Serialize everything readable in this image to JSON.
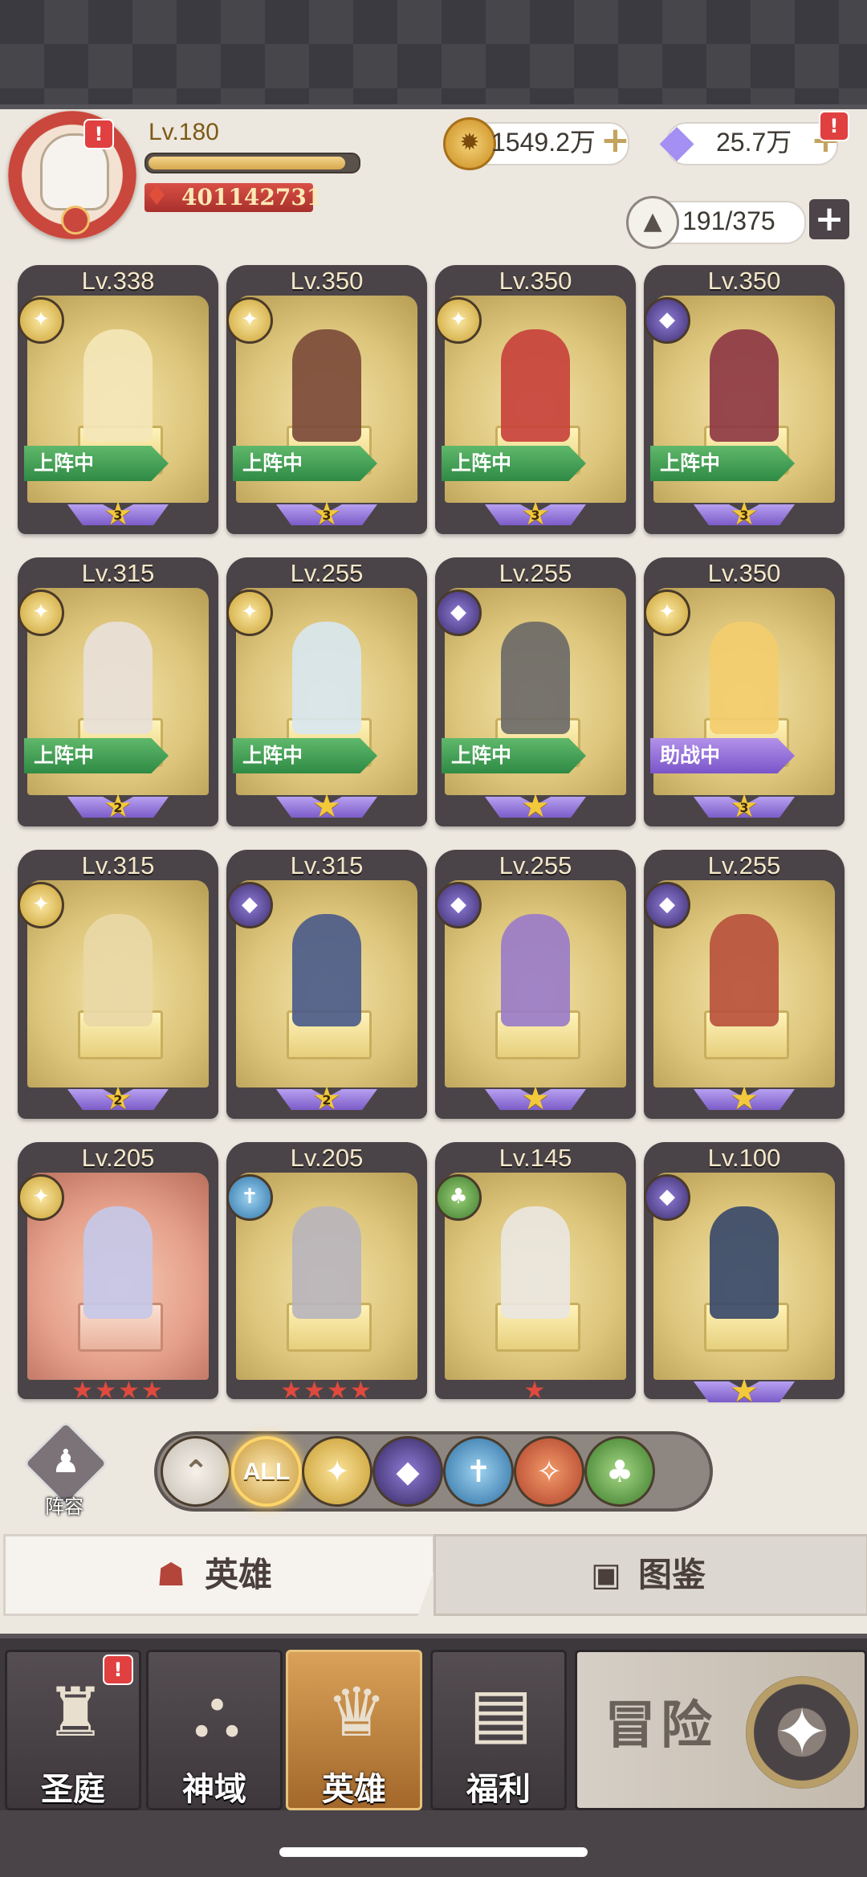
{
  "player": {
    "level": "Lv.180",
    "xp_fraction": 0.96,
    "power": "401142731",
    "alert": "!"
  },
  "resources": {
    "gold": "1549.2万",
    "diamonds": "25.7万",
    "diamond_alert": "!",
    "hero_capacity": "191/375"
  },
  "heroes": [
    {
      "level": "Lv.338",
      "faction": "light",
      "status": "上阵中",
      "stars": "3",
      "frame": "gold"
    },
    {
      "level": "Lv.350",
      "faction": "light",
      "status": "上阵中",
      "stars": "3",
      "frame": "gold"
    },
    {
      "level": "Lv.350",
      "faction": "light",
      "status": "上阵中",
      "stars": "3",
      "frame": "gold"
    },
    {
      "level": "Lv.350",
      "faction": "dark",
      "status": "上阵中",
      "stars": "3",
      "frame": "gold"
    },
    {
      "level": "Lv.315",
      "faction": "light",
      "status": "上阵中",
      "stars": "2",
      "frame": "gold"
    },
    {
      "level": "Lv.255",
      "faction": "light",
      "status": "上阵中",
      "stars": "",
      "frame": "gold"
    },
    {
      "level": "Lv.255",
      "faction": "dark",
      "status": "上阵中",
      "stars": "",
      "frame": "gold"
    },
    {
      "level": "Lv.350",
      "faction": "light",
      "status": "助战中",
      "stars": "3",
      "frame": "gold"
    },
    {
      "level": "Lv.315",
      "faction": "light",
      "status": "",
      "stars": "2",
      "frame": "gold"
    },
    {
      "level": "Lv.315",
      "faction": "dark",
      "status": "",
      "stars": "2",
      "frame": "gold"
    },
    {
      "level": "Lv.255",
      "faction": "dark",
      "status": "",
      "stars": "",
      "frame": "gold"
    },
    {
      "level": "Lv.255",
      "faction": "dark",
      "status": "",
      "stars": "",
      "frame": "gold"
    },
    {
      "level": "Lv.205",
      "faction": "light",
      "status": "",
      "stars": "★★★★",
      "frame": "red"
    },
    {
      "level": "Lv.205",
      "faction": "frost",
      "status": "",
      "stars": "★★★★",
      "frame": "gold"
    },
    {
      "level": "Lv.145",
      "faction": "nature",
      "status": "",
      "stars": "★",
      "frame": "gold"
    },
    {
      "level": "Lv.100",
      "faction": "dark",
      "status": "",
      "stars": "",
      "frame": "gold"
    }
  ],
  "lineup": {
    "label": "阵容"
  },
  "filters": [
    {
      "id": "up",
      "label": "⌃"
    },
    {
      "id": "all",
      "label": "ALL"
    },
    {
      "id": "light",
      "label": "✦"
    },
    {
      "id": "dark",
      "label": "◆"
    },
    {
      "id": "frost",
      "label": "✝"
    },
    {
      "id": "fire",
      "label": "✧"
    },
    {
      "id": "nature",
      "label": "♣"
    }
  ],
  "tabs": {
    "heroes": "英雄",
    "codex": "图鉴"
  },
  "nav": {
    "court": "圣庭",
    "domain": "神域",
    "heroes": "英雄",
    "welfare": "福利",
    "adventure": "冒险",
    "court_alert": "!"
  },
  "colors": {
    "accent_gold": "#d7a84e",
    "status_green": "#2f8a45",
    "status_purple": "#7a55c9",
    "alert_red": "#e04040"
  }
}
